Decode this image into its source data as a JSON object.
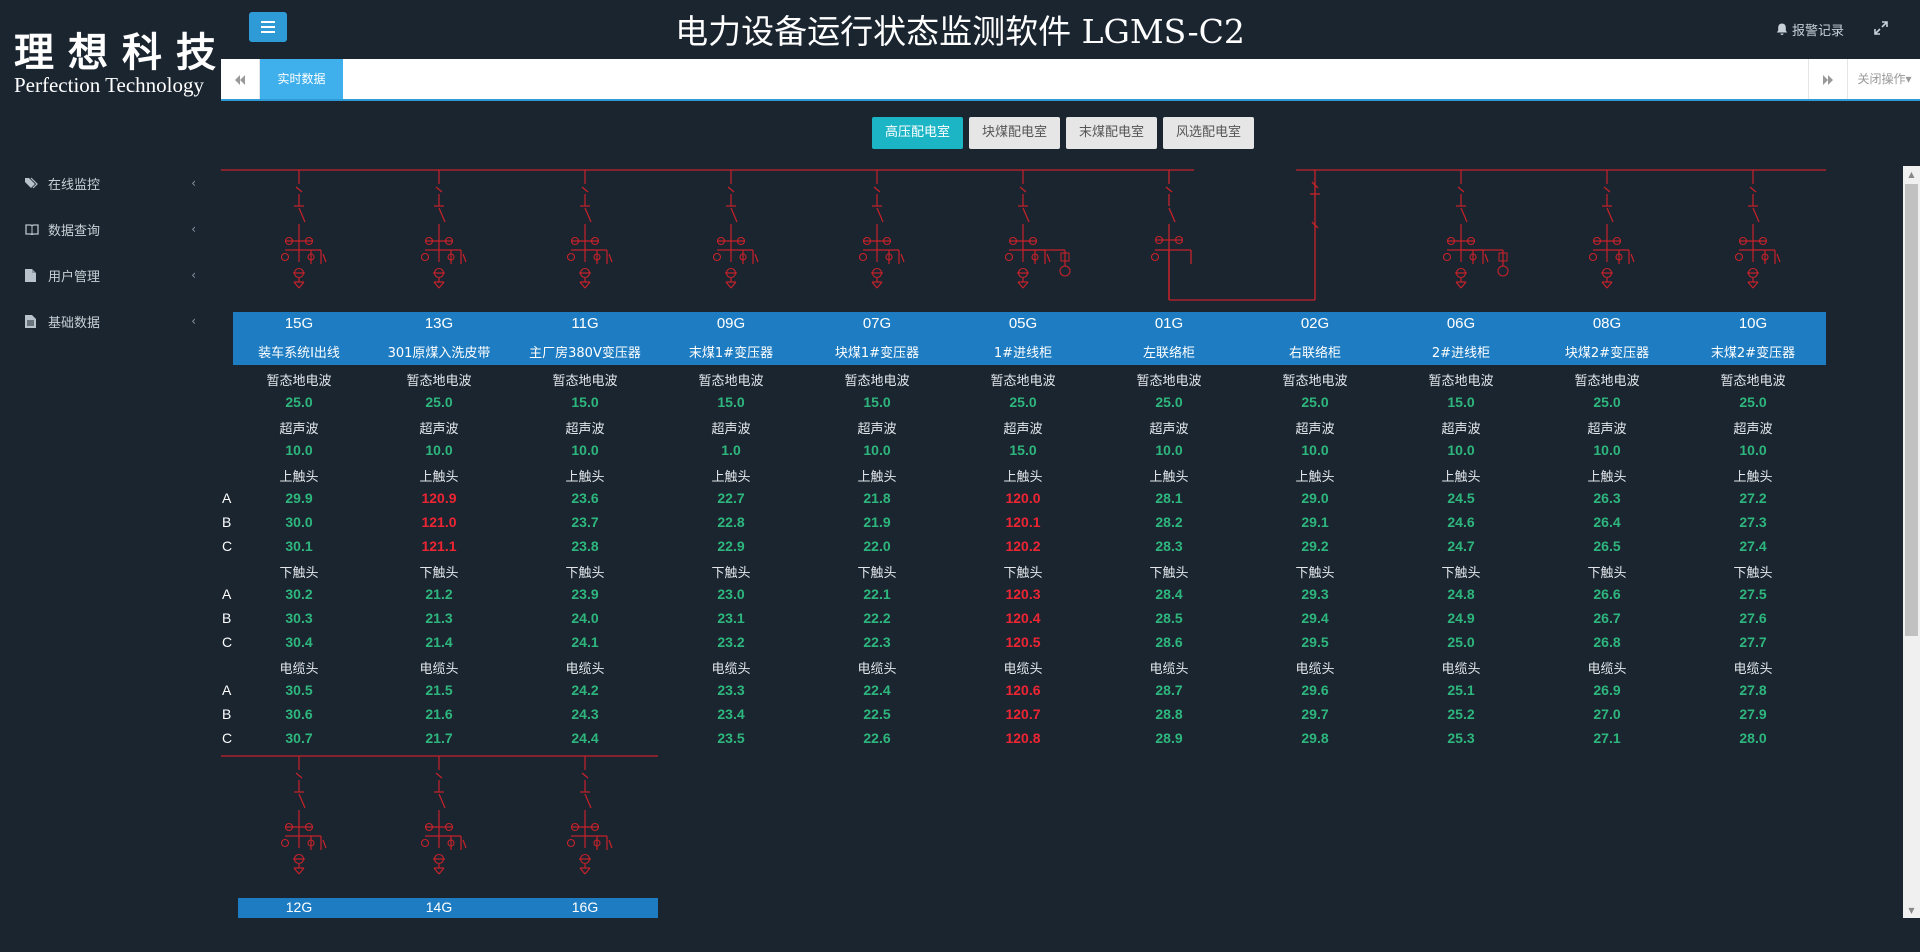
{
  "header": {
    "logo_cn": "理想科技",
    "logo_en": "Perfection Technology",
    "title": "电力设备运行状态监测软件 LGMS-C2",
    "alarm_label": "报警记录"
  },
  "tabs": {
    "active_label": "实时数据",
    "close_label": "关闭操作"
  },
  "sidebar": {
    "items": [
      {
        "label": "在线监控",
        "icon": "tags-icon"
      },
      {
        "label": "数据查询",
        "icon": "book-icon"
      },
      {
        "label": "用户管理",
        "icon": "file-icon"
      },
      {
        "label": "基础数据",
        "icon": "file-icon"
      }
    ]
  },
  "rooms": [
    "高压配电室",
    "块煤配电室",
    "末煤配电室",
    "风选配电室"
  ],
  "labels": {
    "tev": "暂态地电波",
    "ultra": "超声波",
    "upper": "上触头",
    "lower": "下触头",
    "cable": "电缆头",
    "phases": [
      "A",
      "B",
      "C"
    ]
  },
  "colors": {
    "ok": "#2eb67d",
    "alarm": "#ee2532",
    "band": "#1e7cc2",
    "line": "#c8222a"
  },
  "cabinets": [
    {
      "code": "15G",
      "name": "装车系统Ⅰ出线",
      "tev": "25.0",
      "ultra": "10.0",
      "upper": [
        "29.9",
        "30.0",
        "30.1"
      ],
      "lower": [
        "30.2",
        "30.3",
        "30.4"
      ],
      "cable": [
        "30.5",
        "30.6",
        "30.7"
      ],
      "alarm": {
        "upper": false,
        "lower": false,
        "cable": false
      }
    },
    {
      "code": "13G",
      "name": "301原煤入洗皮带",
      "tev": "25.0",
      "ultra": "10.0",
      "upper": [
        "120.9",
        "121.0",
        "121.1"
      ],
      "lower": [
        "21.2",
        "21.3",
        "21.4"
      ],
      "cable": [
        "21.5",
        "21.6",
        "21.7"
      ],
      "alarm": {
        "upper": true,
        "lower": false,
        "cable": false
      }
    },
    {
      "code": "11G",
      "name": "主厂房380V变压器",
      "tev": "15.0",
      "ultra": "10.0",
      "upper": [
        "23.6",
        "23.7",
        "23.8"
      ],
      "lower": [
        "23.9",
        "24.0",
        "24.1"
      ],
      "cable": [
        "24.2",
        "24.3",
        "24.4"
      ],
      "alarm": {
        "upper": false,
        "lower": false,
        "cable": false
      }
    },
    {
      "code": "09G",
      "name": "末煤1#变压器",
      "tev": "15.0",
      "ultra": "1.0",
      "upper": [
        "22.7",
        "22.8",
        "22.9"
      ],
      "lower": [
        "23.0",
        "23.1",
        "23.2"
      ],
      "cable": [
        "23.3",
        "23.4",
        "23.5"
      ],
      "alarm": {
        "upper": false,
        "lower": false,
        "cable": false
      }
    },
    {
      "code": "07G",
      "name": "块煤1#变压器",
      "tev": "15.0",
      "ultra": "10.0",
      "upper": [
        "21.8",
        "21.9",
        "22.0"
      ],
      "lower": [
        "22.1",
        "22.2",
        "22.3"
      ],
      "cable": [
        "22.4",
        "22.5",
        "22.6"
      ],
      "alarm": {
        "upper": false,
        "lower": false,
        "cable": false
      }
    },
    {
      "code": "05G",
      "name": "1#进线柜",
      "tev": "25.0",
      "ultra": "15.0",
      "upper": [
        "120.0",
        "120.1",
        "120.2"
      ],
      "lower": [
        "120.3",
        "120.4",
        "120.5"
      ],
      "cable": [
        "120.6",
        "120.7",
        "120.8"
      ],
      "alarm": {
        "upper": true,
        "lower": true,
        "cable": true
      }
    },
    {
      "code": "01G",
      "name": "左联络柜",
      "tev": "25.0",
      "ultra": "10.0",
      "upper": [
        "28.1",
        "28.2",
        "28.3"
      ],
      "lower": [
        "28.4",
        "28.5",
        "28.6"
      ],
      "cable": [
        "28.7",
        "28.8",
        "28.9"
      ],
      "alarm": {
        "upper": false,
        "lower": false,
        "cable": false
      }
    },
    {
      "code": "02G",
      "name": "右联络柜",
      "tev": "25.0",
      "ultra": "10.0",
      "upper": [
        "29.0",
        "29.1",
        "29.2"
      ],
      "lower": [
        "29.3",
        "29.4",
        "29.5"
      ],
      "cable": [
        "29.6",
        "29.7",
        "29.8"
      ],
      "alarm": {
        "upper": false,
        "lower": false,
        "cable": false
      }
    },
    {
      "code": "06G",
      "name": "2#进线柜",
      "tev": "15.0",
      "ultra": "10.0",
      "upper": [
        "24.5",
        "24.6",
        "24.7"
      ],
      "lower": [
        "24.8",
        "24.9",
        "25.0"
      ],
      "cable": [
        "25.1",
        "25.2",
        "25.3"
      ],
      "alarm": {
        "upper": false,
        "lower": false,
        "cable": false
      }
    },
    {
      "code": "08G",
      "name": "块煤2#变压器",
      "tev": "25.0",
      "ultra": "10.0",
      "upper": [
        "26.3",
        "26.4",
        "26.5"
      ],
      "lower": [
        "26.6",
        "26.7",
        "26.8"
      ],
      "cable": [
        "26.9",
        "27.0",
        "27.1"
      ],
      "alarm": {
        "upper": false,
        "lower": false,
        "cable": false
      }
    },
    {
      "code": "10G",
      "name": "末煤2#变压器",
      "tev": "25.0",
      "ultra": "10.0",
      "upper": [
        "27.2",
        "27.3",
        "27.4"
      ],
      "lower": [
        "27.5",
        "27.6",
        "27.7"
      ],
      "cable": [
        "27.8",
        "27.9",
        "28.0"
      ],
      "alarm": {
        "upper": false,
        "lower": false,
        "cable": false
      }
    }
  ],
  "cabinets_row2": [
    {
      "code": "12G"
    },
    {
      "code": "14G"
    },
    {
      "code": "16G"
    }
  ]
}
